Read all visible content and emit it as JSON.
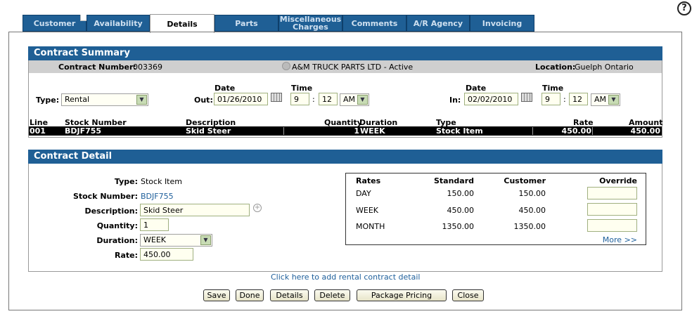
{
  "help_icon": "?",
  "tabs": [
    {
      "label": "Customer"
    },
    {
      "label": "Availability"
    },
    {
      "label": "Details"
    },
    {
      "label": "Parts"
    },
    {
      "label": "Miscellaneous Charges"
    },
    {
      "label": "Comments"
    },
    {
      "label": "A/R Agency"
    },
    {
      "label": "Invoicing"
    }
  ],
  "summary": {
    "title": "Contract Summary",
    "contract_number_label": "Contract Number:",
    "contract_number": "003369",
    "customer": "A&M TRUCK PARTS LTD - Active",
    "location_label": "Location:",
    "location": "Guelph Ontario",
    "type_label": "Type:",
    "type_value": "Rental",
    "date_label": "Date",
    "time_label": "Time",
    "out_label": "Out:",
    "out_date": "01/26/2010",
    "out_hour": "9",
    "out_minute": "12",
    "out_ampm": "AM",
    "in_label": "In:",
    "in_date": "02/02/2010",
    "in_hour": "9",
    "in_minute": "12",
    "in_ampm": "AM",
    "colon": ":"
  },
  "lines_table": {
    "headers": {
      "line": "Line",
      "stock": "Stock Number",
      "desc": "Description",
      "qty": "Quantity",
      "duration": "Duration",
      "type": "Type",
      "rate": "Rate",
      "amount": "Amount"
    },
    "row": {
      "line": "001",
      "stock": "BDJF755",
      "desc": "Skid Steer",
      "qty": "1",
      "duration": "WEEK",
      "type": "Stock Item",
      "rate": "450.00",
      "amount": "450.00"
    }
  },
  "detail": {
    "title": "Contract Detail",
    "type_label": "Type:",
    "type_value": "Stock Item",
    "stock_label": "Stock Number:",
    "stock_value": "BDJF755",
    "desc_label": "Description:",
    "desc_value": "Skid Steer",
    "qty_label": "Quantity:",
    "qty_value": "1",
    "duration_label": "Duration:",
    "duration_value": "WEEK",
    "rate_label": "Rate:",
    "rate_value": "450.00"
  },
  "rates": {
    "headers": {
      "rates": "Rates",
      "standard": "Standard",
      "customer": "Customer",
      "override": "Override"
    },
    "rows": [
      {
        "name": "DAY",
        "standard": "150.00",
        "customer": "150.00"
      },
      {
        "name": "WEEK",
        "standard": "450.00",
        "customer": "450.00"
      },
      {
        "name": "MONTH",
        "standard": "1350.00",
        "customer": "1350.00"
      }
    ],
    "more_link": "More >>"
  },
  "add_link": "Click here to add rental contract detail",
  "buttons": {
    "save": "Save",
    "done": "Done",
    "details": "Details",
    "delete": "Delete",
    "package_pricing": "Package Pricing",
    "close": "Close"
  }
}
